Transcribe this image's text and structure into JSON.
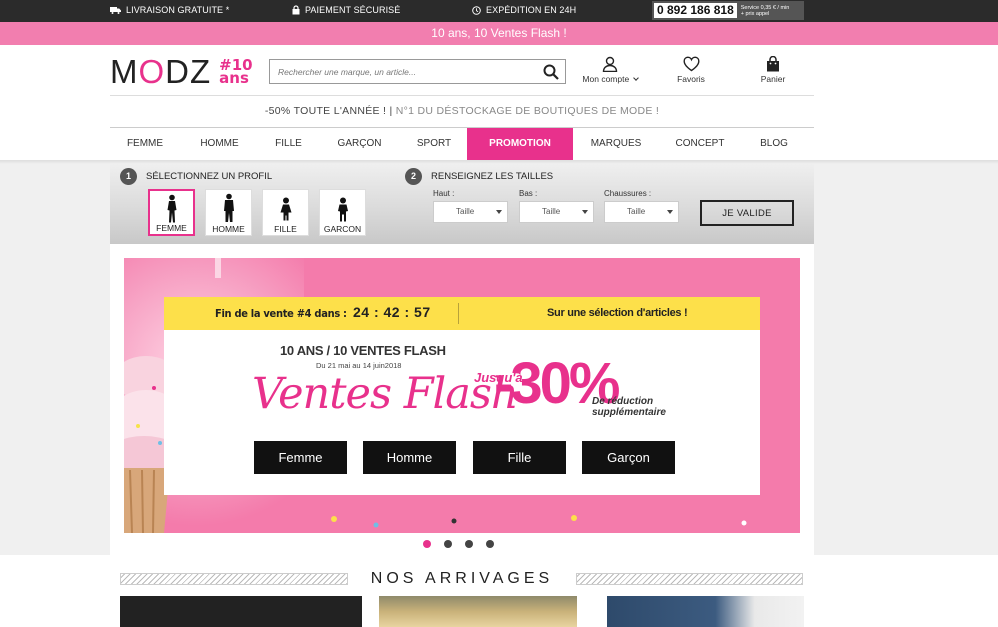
{
  "topbar": {
    "free_delivery": "LIVRAISON GRATUITE *",
    "secure_payment": "PAIEMENT SÉCURISÉ",
    "shipping": "EXPÉDITION EN 24H",
    "phone": "0 892 186 818",
    "phone_note_1": "Service 0,35 € / min",
    "phone_note_2": "+ prix appel"
  },
  "banner": {
    "text": "10 ans, 10 Ventes Flash !"
  },
  "header": {
    "logo_text_m": "M",
    "logo_text_o": "O",
    "logo_text_dz": "DZ",
    "logo_anniv_1": "#10",
    "logo_anniv_2": "ans",
    "search_placeholder": "Rechercher une marque, un article...",
    "account_label": "Mon compte",
    "favorites_label": "Favoris",
    "cart_label": "Panier",
    "promo_main": "-50% TOUTE L'ANNÉE ! |",
    "promo_sub": "N°1 DU DÉSTOCKAGE DE BOUTIQUES DE MODE !"
  },
  "nav": {
    "items": [
      "FEMME",
      "HOMME",
      "FILLE",
      "GARÇON",
      "SPORT",
      "PROMOTION",
      "MARQUES",
      "CONCEPT",
      "BLOG"
    ],
    "active": "PROMOTION"
  },
  "profile": {
    "step1_num": "1",
    "step1_label": "SÉLECTIONNEZ UN PROFIL",
    "step2_num": "2",
    "step2_label": "RENSEIGNEZ LES TAILLES",
    "profiles": [
      "FEMME",
      "HOMME",
      "FILLE",
      "GARCON"
    ],
    "selected_profile": "FEMME",
    "size_groups": [
      {
        "label": "Haut :",
        "value": "Taille"
      },
      {
        "label": "Bas :",
        "value": "Taille"
      },
      {
        "label": "Chaussures :",
        "value": "Taille"
      }
    ],
    "validate_label": "JE VALIDE"
  },
  "slider": {
    "countdown_label": "Fin de la vente #4 dans :",
    "countdown_time": "24 : 42 : 57",
    "selection_label": "Sur une sélection d'articles !",
    "headline": "10 ANS / 10 VENTES FLASH",
    "dates": "Du 21 mai au 14 juin2018",
    "script_title": "Ventes Flash",
    "upto": "Jusqu'à",
    "percent": "-30%",
    "reduction_1": "De réduction",
    "reduction_2": "supplémentaire",
    "ctas": [
      "Femme",
      "Homme",
      "Fille",
      "Garçon"
    ],
    "dot_count": 4,
    "active_dot": 1,
    "colors": {
      "pink": "#f47bab",
      "accent": "#e8318c",
      "yellow": "#fde04a"
    }
  },
  "arrivals": {
    "title": "NOS ARRIVAGES"
  }
}
